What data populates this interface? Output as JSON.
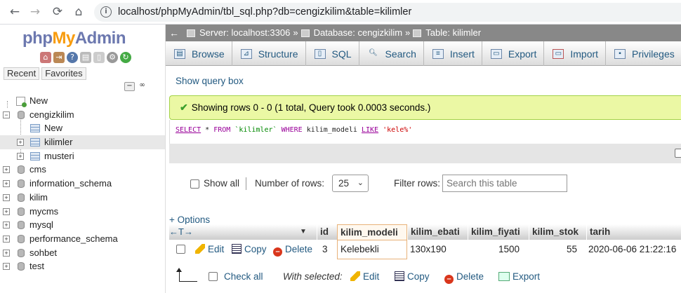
{
  "browser": {
    "url": "localhost/phpMyAdmin/tbl_sql.php?db=cengizkilim&table=kilimler"
  },
  "sidebar": {
    "logo": {
      "php": "php",
      "my": "My",
      "admin": "Admin"
    },
    "tabs": [
      "Recent",
      "Favorites"
    ],
    "tree": [
      {
        "label": "New",
        "type": "new",
        "level": 0
      },
      {
        "label": "cengizkilim",
        "type": "db",
        "level": 0,
        "expanded": true
      },
      {
        "label": "New",
        "type": "new",
        "level": 1
      },
      {
        "label": "kilimler",
        "type": "table",
        "level": 1,
        "selected": true
      },
      {
        "label": "musteri",
        "type": "table",
        "level": 1
      },
      {
        "label": "cms",
        "type": "db",
        "level": 0
      },
      {
        "label": "information_schema",
        "type": "db",
        "level": 0
      },
      {
        "label": "kilim",
        "type": "db",
        "level": 0
      },
      {
        "label": "mycms",
        "type": "db",
        "level": 0
      },
      {
        "label": "mysql",
        "type": "db",
        "level": 0
      },
      {
        "label": "performance_schema",
        "type": "db",
        "level": 0
      },
      {
        "label": "sohbet",
        "type": "db",
        "level": 0
      },
      {
        "label": "test",
        "type": "db",
        "level": 0
      }
    ]
  },
  "breadcrumb": {
    "server": "Server: localhost:3306",
    "database": "Database: cengizkilim",
    "table": "Table: kilimler",
    "sep": "»"
  },
  "menu": [
    "Browse",
    "Structure",
    "SQL",
    "Search",
    "Insert",
    "Export",
    "Import",
    "Privileges"
  ],
  "show_query_box": "Show query box",
  "success_message": "Showing rows 0 - 0 (1 total, Query took 0.0003 seconds.)",
  "sql": {
    "select": "SELECT",
    "star": " * ",
    "from": "FROM",
    "table": "`kilimler`",
    "where": "WHERE",
    "column": "kilim_modeli",
    "like": "LIKE",
    "pattern": "'kele%'"
  },
  "controls": {
    "show_all": "Show all",
    "number_of_rows_label": "Number of rows:",
    "number_of_rows_value": "25",
    "filter_rows_label": "Filter rows:",
    "filter_placeholder": "Search this table"
  },
  "options_link": "+ Options",
  "table": {
    "columns": [
      "id",
      "kilim_modeli",
      "kilim_ebati",
      "kilim_fiyati",
      "kilim_stok",
      "tarih"
    ],
    "rows": [
      {
        "id": "3",
        "kilim_modeli": "Kelebekli",
        "kilim_ebati": "130x190",
        "kilim_fiyati": "1500",
        "kilim_stok": "55",
        "tarih": "2020-06-06 21:22:16"
      }
    ],
    "row_actions": {
      "edit": "Edit",
      "copy": "Copy",
      "delete": "Delete"
    }
  },
  "footer": {
    "check_all": "Check all",
    "with_selected": "With selected:",
    "edit": "Edit",
    "copy": "Copy",
    "delete": "Delete",
    "export": "Export"
  }
}
